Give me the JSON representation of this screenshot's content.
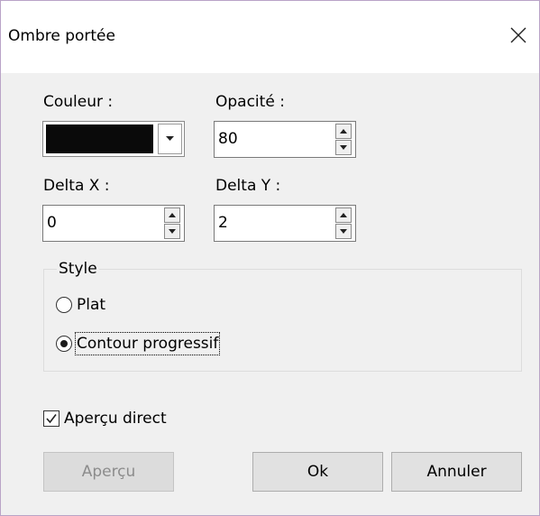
{
  "window": {
    "title": "Ombre portée",
    "close_icon": "close-icon"
  },
  "color": {
    "label": "Couleur :",
    "value": "#0a0a0a",
    "dropdown_icon": "chevron-down-icon"
  },
  "opacity": {
    "label": "Opacité :",
    "value": "80"
  },
  "delta_x": {
    "label": "Delta X :",
    "value": "0"
  },
  "delta_y": {
    "label": "Delta Y :",
    "value": "2"
  },
  "style_group": {
    "title": "Style",
    "options": [
      {
        "label": "Plat",
        "selected": false
      },
      {
        "label": "Contour progressif",
        "selected": true
      }
    ]
  },
  "live_preview": {
    "label": "Aperçu direct",
    "checked": true
  },
  "buttons": {
    "preview": {
      "label": "Aperçu",
      "enabled": false
    },
    "ok": {
      "label": "Ok",
      "enabled": true
    },
    "cancel": {
      "label": "Annuler",
      "enabled": true
    }
  }
}
